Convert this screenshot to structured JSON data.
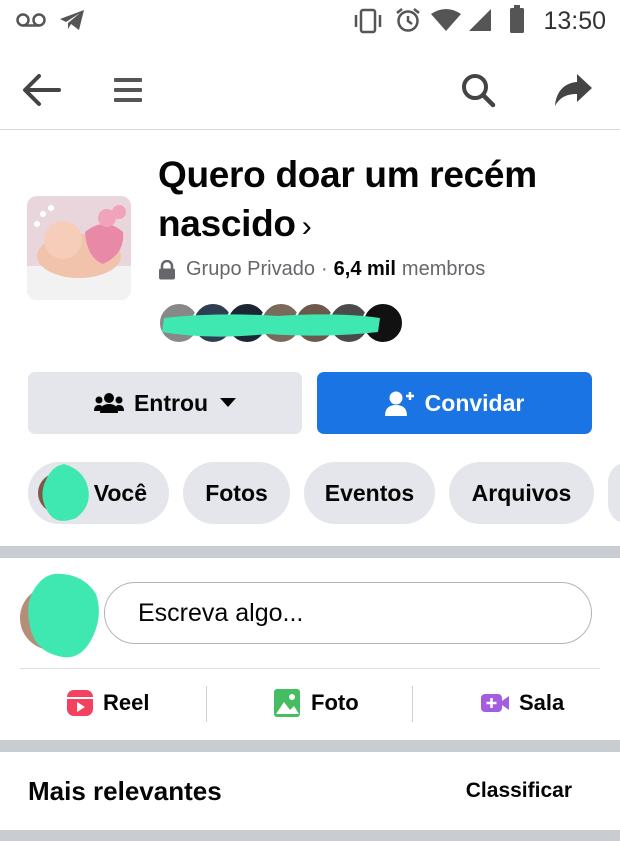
{
  "status_bar": {
    "time": "13:50",
    "icons": [
      "voicemail-icon",
      "telegram-icon",
      "vibrate-icon",
      "alarm-icon",
      "wifi-icon",
      "signal-icon",
      "battery-icon"
    ]
  },
  "app_bar": {
    "icons": [
      "back-arrow-icon",
      "menu-icon",
      "search-icon",
      "share-icon"
    ]
  },
  "group": {
    "title": "Quero doar um recém nascido",
    "chevron": "›",
    "privacy": "Grupo Privado",
    "separator": "·",
    "member_count": "6,4 mil",
    "members_label": "membros"
  },
  "actions": {
    "joined_label": "Entrou",
    "invite_label": "Convidar"
  },
  "chips": [
    "Você",
    "Fotos",
    "Eventos",
    "Arquivos"
  ],
  "composer": {
    "placeholder": "Escreva algo...",
    "reel_label": "Reel",
    "photo_label": "Foto",
    "room_label": "Sala"
  },
  "feed": {
    "sort_heading": "Mais relevantes",
    "sort_button": "Classificar"
  },
  "colors": {
    "primary": "#1b74e4",
    "chip_bg": "#e4e6eb",
    "redaction": "#3ee8b0"
  }
}
